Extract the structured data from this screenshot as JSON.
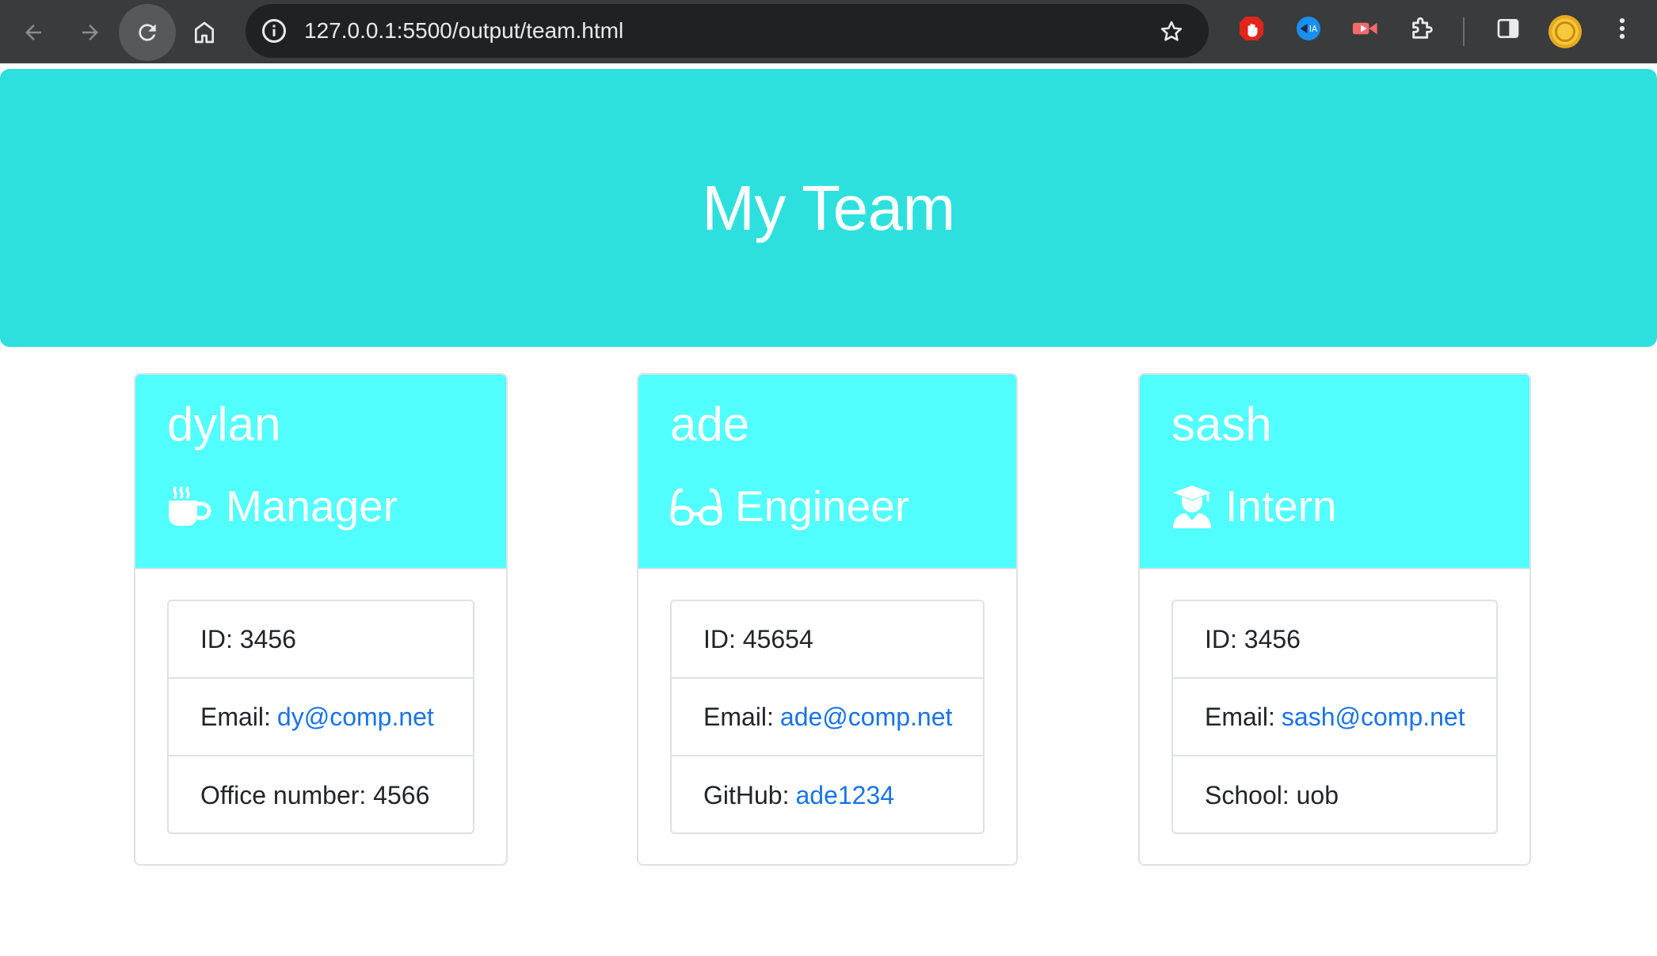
{
  "browser": {
    "url": "127.0.0.1:5500/output/team.html",
    "icons": [
      "back-icon",
      "forward-icon",
      "reload-icon",
      "home-icon",
      "info-icon",
      "bookmark-star-icon",
      "adblock-extension-icon",
      "bilingual-extension-icon",
      "video-extension-icon",
      "extensions-puzzle-icon",
      "side-panel-icon",
      "profile-avatar",
      "more-menu-icon"
    ]
  },
  "header": {
    "title": "My Team"
  },
  "team": [
    {
      "name": "dylan",
      "role": "Manager",
      "role_icon": "coffee-mug-icon",
      "id_label": "ID:",
      "id": "3456",
      "email_label": "Email:",
      "email": "dy@comp.net",
      "extra_label": "Office number:",
      "extra_value": "4566",
      "extra_is_link": false
    },
    {
      "name": "ade",
      "role": "Engineer",
      "role_icon": "glasses-icon",
      "id_label": "ID:",
      "id": "45654",
      "email_label": "Email:",
      "email": "ade@comp.net",
      "extra_label": "GitHub:",
      "extra_value": "ade1234",
      "extra_is_link": true
    },
    {
      "name": "sash",
      "role": "Intern",
      "role_icon": "graduate-icon",
      "id_label": "ID:",
      "id": "3456",
      "email_label": "Email:",
      "email": "sash@comp.net",
      "extra_label": "School:",
      "extra_value": "uob",
      "extra_is_link": false
    }
  ],
  "colors": {
    "jumbotron": "#2ee0dd",
    "card_header": "#52ffff",
    "link": "#1a73e8",
    "chrome": "#3a3b3d"
  }
}
